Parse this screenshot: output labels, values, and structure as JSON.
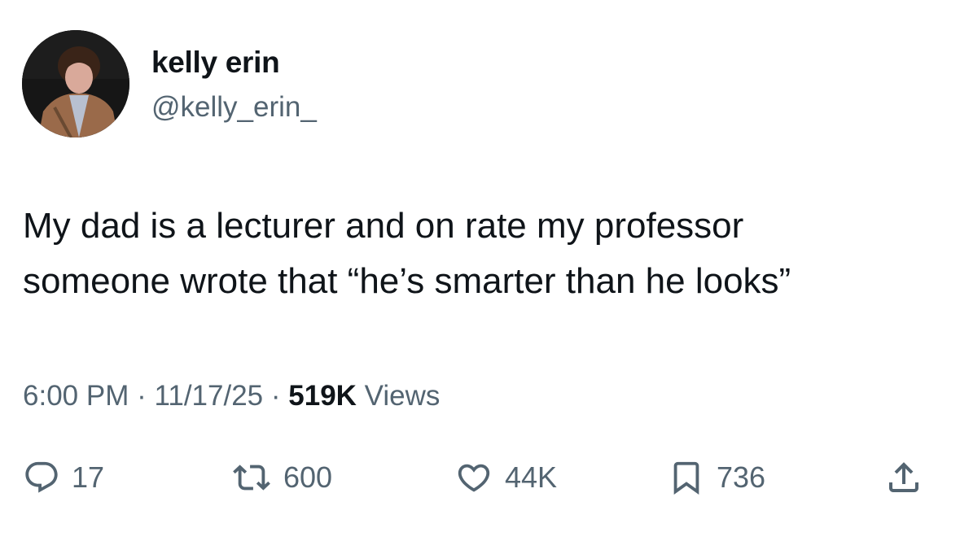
{
  "author": {
    "display_name": "kelly erin",
    "handle": "@kelly_erin_"
  },
  "tweet": {
    "text_lines": [
      "My dad is a lecturer and on rate my professor",
      "someone wrote that “he’s smarter than he looks”"
    ]
  },
  "meta": {
    "time": "6:00 PM",
    "separator": "·",
    "date": "11/17/25",
    "views_count": "519K",
    "views_label": "Views"
  },
  "actions": {
    "reply": {
      "icon": "reply-icon",
      "count": "17"
    },
    "retweet": {
      "icon": "retweet-icon",
      "count": "600"
    },
    "like": {
      "icon": "heart-icon",
      "count": "44K"
    },
    "bookmark": {
      "icon": "bookmark-icon",
      "count": "736"
    },
    "share": {
      "icon": "share-icon"
    }
  },
  "colors": {
    "text_primary": "#0f1419",
    "text_secondary": "#536471",
    "background": "#ffffff"
  }
}
